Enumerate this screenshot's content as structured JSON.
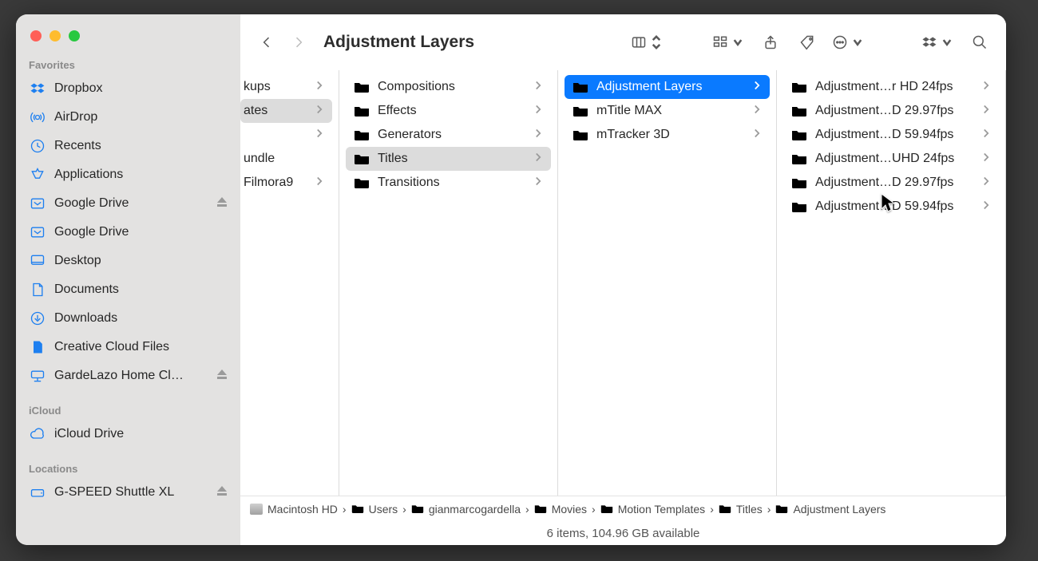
{
  "window_title": "Adjustment Layers",
  "sidebar": {
    "sections": [
      {
        "label": "Favorites",
        "items": [
          {
            "icon": "dropbox",
            "label": "Dropbox",
            "eject": false
          },
          {
            "icon": "airdrop",
            "label": "AirDrop",
            "eject": false
          },
          {
            "icon": "clock",
            "label": "Recents",
            "eject": false
          },
          {
            "icon": "apps",
            "label": "Applications",
            "eject": false
          },
          {
            "icon": "gdrive",
            "label": "Google Drive",
            "eject": true
          },
          {
            "icon": "gdrive",
            "label": "Google Drive",
            "eject": false
          },
          {
            "icon": "desktop",
            "label": "Desktop",
            "eject": false
          },
          {
            "icon": "document",
            "label": "Documents",
            "eject": false
          },
          {
            "icon": "download",
            "label": "Downloads",
            "eject": false
          },
          {
            "icon": "file-solid",
            "label": "Creative Cloud Files",
            "eject": false
          },
          {
            "icon": "network",
            "label": "GardeLazo Home Cl…",
            "eject": true
          }
        ]
      },
      {
        "label": "iCloud",
        "items": [
          {
            "icon": "cloud",
            "label": "iCloud Drive",
            "eject": false
          }
        ]
      },
      {
        "label": "Locations",
        "items": [
          {
            "icon": "drive",
            "label": "G-SPEED Shuttle XL",
            "eject": true
          }
        ]
      }
    ]
  },
  "columns": [
    {
      "items": [
        {
          "label": "kups",
          "chev": true,
          "folder": false
        },
        {
          "label": "ates",
          "chev": true,
          "folder": false,
          "sel": "light"
        },
        {
          "label": "",
          "chev": true,
          "folder": false
        },
        {
          "label": "undle",
          "chev": false,
          "folder": false
        },
        {
          "label": "Filmora9",
          "chev": true,
          "folder": false
        }
      ]
    },
    {
      "items": [
        {
          "label": "Compositions",
          "chev": true,
          "folder": true
        },
        {
          "label": "Effects",
          "chev": true,
          "folder": true
        },
        {
          "label": "Generators",
          "chev": true,
          "folder": true
        },
        {
          "label": "Titles",
          "chev": true,
          "folder": true,
          "sel": "light"
        },
        {
          "label": "Transitions",
          "chev": true,
          "folder": true
        }
      ]
    },
    {
      "items": [
        {
          "label": "Adjustment Layers",
          "chev": true,
          "folder": true,
          "sel": "blue"
        },
        {
          "label": "mTitle MAX",
          "chev": true,
          "folder": true
        },
        {
          "label": "mTracker 3D",
          "chev": true,
          "folder": true
        }
      ]
    },
    {
      "items": [
        {
          "label": "Adjustment…r HD 24fps",
          "chev": true,
          "folder": true
        },
        {
          "label": "Adjustment…D 29.97fps",
          "chev": true,
          "folder": true
        },
        {
          "label": "Adjustment…D 59.94fps",
          "chev": true,
          "folder": true
        },
        {
          "label": "Adjustment…UHD 24fps",
          "chev": true,
          "folder": true
        },
        {
          "label": "Adjustment…D 29.97fps",
          "chev": true,
          "folder": true
        },
        {
          "label": "Adjustment…D 59.94fps",
          "chev": true,
          "folder": true
        }
      ]
    }
  ],
  "path": [
    {
      "icon": "disk",
      "label": "Macintosh HD"
    },
    {
      "icon": "folder",
      "label": "Users"
    },
    {
      "icon": "folder",
      "label": "gianmarcogardella"
    },
    {
      "icon": "folder",
      "label": "Movies"
    },
    {
      "icon": "folder",
      "label": "Motion Templates"
    },
    {
      "icon": "folder",
      "label": "Titles"
    },
    {
      "icon": "folder",
      "label": "Adjustment Layers"
    }
  ],
  "status": "6 items, 104.96 GB available"
}
